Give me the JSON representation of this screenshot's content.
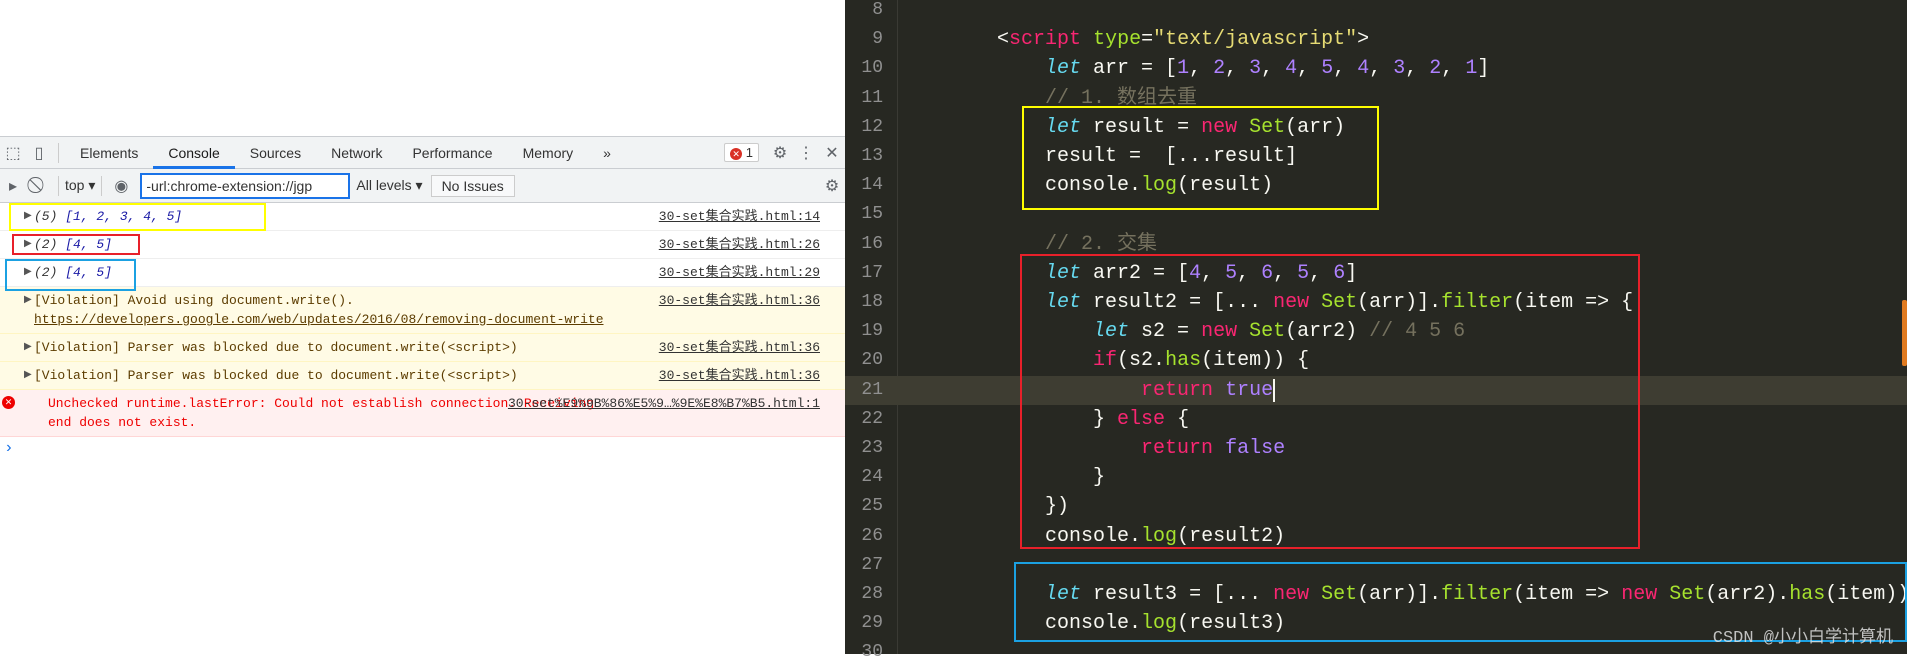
{
  "devtools": {
    "tabs": [
      "Elements",
      "Console",
      "Sources",
      "Network",
      "Performance",
      "Memory"
    ],
    "active_tab": "Console",
    "more": "»",
    "error_count": "1",
    "context": "top",
    "filter_value": "-url:chrome-extension://jgp",
    "levels": "All levels",
    "issues": "No Issues",
    "console": [
      {
        "type": "log",
        "count": "(5)",
        "value": "[1, 2, 3, 4, 5]",
        "source": "30-set集合实践.html:14"
      },
      {
        "type": "log",
        "count": "(2)",
        "value": "[4, 5]",
        "source": "30-set集合实践.html:26"
      },
      {
        "type": "log",
        "count": "(2)",
        "value": "[4, 5]",
        "source": "30-set集合实践.html:29"
      },
      {
        "type": "warn",
        "text": "[Violation] Avoid using document.write(). ",
        "link": "https://developers.google.com/web/updates/2016/08/removing-document-write",
        "source": "30-set集合实践.html:36"
      },
      {
        "type": "warn",
        "text": "[Violation] Parser was blocked due to document.write(<script>)",
        "source": "30-set集合实践.html:36"
      },
      {
        "type": "warn",
        "text": "[Violation] Parser was blocked due to document.write(<script>)",
        "source": "30-set集合实践.html:36"
      },
      {
        "type": "error",
        "text": "Unchecked runtime.lastError: Could not establish connection. Receiving end does not exist.",
        "source": "30-set%E9%9B%86%E5%9…%9E%E8%B7%B5.html:1"
      }
    ],
    "prompt": "›"
  },
  "editor": {
    "current_line": 21,
    "lines": [
      {
        "n": "8",
        "t": []
      },
      {
        "n": "9",
        "t": [
          [
            "p",
            "        <"
          ],
          [
            "k",
            "script"
          ],
          [
            "p",
            " "
          ],
          [
            "f",
            "type"
          ],
          [
            "p",
            "="
          ],
          [
            "s",
            "\"text/javascript\""
          ],
          [
            "p",
            ">"
          ]
        ]
      },
      {
        "n": "10",
        "t": [
          [
            "p",
            "            "
          ],
          [
            "t",
            "let"
          ],
          [
            "p",
            " arr = ["
          ],
          [
            "n",
            "1"
          ],
          [
            "p",
            ", "
          ],
          [
            "n",
            "2"
          ],
          [
            "p",
            ", "
          ],
          [
            "n",
            "3"
          ],
          [
            "p",
            ", "
          ],
          [
            "n",
            "4"
          ],
          [
            "p",
            ", "
          ],
          [
            "n",
            "5"
          ],
          [
            "p",
            ", "
          ],
          [
            "n",
            "4"
          ],
          [
            "p",
            ", "
          ],
          [
            "n",
            "3"
          ],
          [
            "p",
            ", "
          ],
          [
            "n",
            "2"
          ],
          [
            "p",
            ", "
          ],
          [
            "n",
            "1"
          ],
          [
            "p",
            "]"
          ]
        ]
      },
      {
        "n": "11",
        "t": [
          [
            "p",
            "            "
          ],
          [
            "c",
            "// 1. 数组去重"
          ]
        ]
      },
      {
        "n": "12",
        "t": [
          [
            "p",
            "            "
          ],
          [
            "t",
            "let"
          ],
          [
            "p",
            " result = "
          ],
          [
            "k",
            "new"
          ],
          [
            "p",
            " "
          ],
          [
            "f",
            "Set"
          ],
          [
            "p",
            "(arr)"
          ]
        ]
      },
      {
        "n": "13",
        "t": [
          [
            "p",
            "            result =  [...result]"
          ]
        ]
      },
      {
        "n": "14",
        "t": [
          [
            "p",
            "            console."
          ],
          [
            "f",
            "log"
          ],
          [
            "p",
            "(result)"
          ]
        ]
      },
      {
        "n": "15",
        "t": []
      },
      {
        "n": "16",
        "t": [
          [
            "p",
            "            "
          ],
          [
            "c",
            "// 2. 交集"
          ]
        ]
      },
      {
        "n": "17",
        "t": [
          [
            "p",
            "            "
          ],
          [
            "t",
            "let"
          ],
          [
            "p",
            " arr2 = ["
          ],
          [
            "n",
            "4"
          ],
          [
            "p",
            ", "
          ],
          [
            "n",
            "5"
          ],
          [
            "p",
            ", "
          ],
          [
            "n",
            "6"
          ],
          [
            "p",
            ", "
          ],
          [
            "n",
            "5"
          ],
          [
            "p",
            ", "
          ],
          [
            "n",
            "6"
          ],
          [
            "p",
            "]"
          ]
        ]
      },
      {
        "n": "18",
        "t": [
          [
            "p",
            "            "
          ],
          [
            "t",
            "let"
          ],
          [
            "p",
            " result2 = [... "
          ],
          [
            "k",
            "new"
          ],
          [
            "p",
            " "
          ],
          [
            "f",
            "Set"
          ],
          [
            "p",
            "(arr)]."
          ],
          [
            "f",
            "filter"
          ],
          [
            "p",
            "(item => {"
          ]
        ]
      },
      {
        "n": "19",
        "t": [
          [
            "p",
            "                "
          ],
          [
            "t",
            "let"
          ],
          [
            "p",
            " s2 = "
          ],
          [
            "k",
            "new"
          ],
          [
            "p",
            " "
          ],
          [
            "f",
            "Set"
          ],
          [
            "p",
            "(arr2) "
          ],
          [
            "c",
            "// 4 5 6"
          ]
        ]
      },
      {
        "n": "20",
        "t": [
          [
            "p",
            "                "
          ],
          [
            "k",
            "if"
          ],
          [
            "p",
            "(s2."
          ],
          [
            "f",
            "has"
          ],
          [
            "p",
            "(item)) {"
          ]
        ]
      },
      {
        "n": "21",
        "t": [
          [
            "p",
            "                    "
          ],
          [
            "k",
            "return"
          ],
          [
            "p",
            " "
          ],
          [
            "n",
            "true"
          ]
        ]
      },
      {
        "n": "22",
        "t": [
          [
            "p",
            "                } "
          ],
          [
            "k",
            "else"
          ],
          [
            "p",
            " {"
          ]
        ]
      },
      {
        "n": "23",
        "t": [
          [
            "p",
            "                    "
          ],
          [
            "k",
            "return"
          ],
          [
            "p",
            " "
          ],
          [
            "n",
            "false"
          ]
        ]
      },
      {
        "n": "24",
        "t": [
          [
            "p",
            "                }"
          ]
        ]
      },
      {
        "n": "25",
        "t": [
          [
            "p",
            "            })"
          ]
        ]
      },
      {
        "n": "26",
        "t": [
          [
            "p",
            "            console."
          ],
          [
            "f",
            "log"
          ],
          [
            "p",
            "(result2)"
          ]
        ]
      },
      {
        "n": "27",
        "t": []
      },
      {
        "n": "28",
        "t": [
          [
            "p",
            "            "
          ],
          [
            "t",
            "let"
          ],
          [
            "p",
            " result3 = [... "
          ],
          [
            "k",
            "new"
          ],
          [
            "p",
            " "
          ],
          [
            "f",
            "Set"
          ],
          [
            "p",
            "(arr)]."
          ],
          [
            "f",
            "filter"
          ],
          [
            "p",
            "(item => "
          ],
          [
            "k",
            "new"
          ],
          [
            "p",
            " "
          ],
          [
            "f",
            "Set"
          ],
          [
            "p",
            "(arr2)."
          ],
          [
            "f",
            "has"
          ],
          [
            "p",
            "(item))"
          ]
        ]
      },
      {
        "n": "29",
        "t": [
          [
            "p",
            "            console."
          ],
          [
            "f",
            "log"
          ],
          [
            "p",
            "(result3)"
          ]
        ]
      },
      {
        "n": "30",
        "t": []
      }
    ]
  },
  "watermark": "CSDN @小小白学计算机",
  "colors": {
    "yellow_box": "#ffff00",
    "red_box": "#e8202a",
    "blue_box": "#1ba1e2",
    "editor_bg": "#272822"
  }
}
